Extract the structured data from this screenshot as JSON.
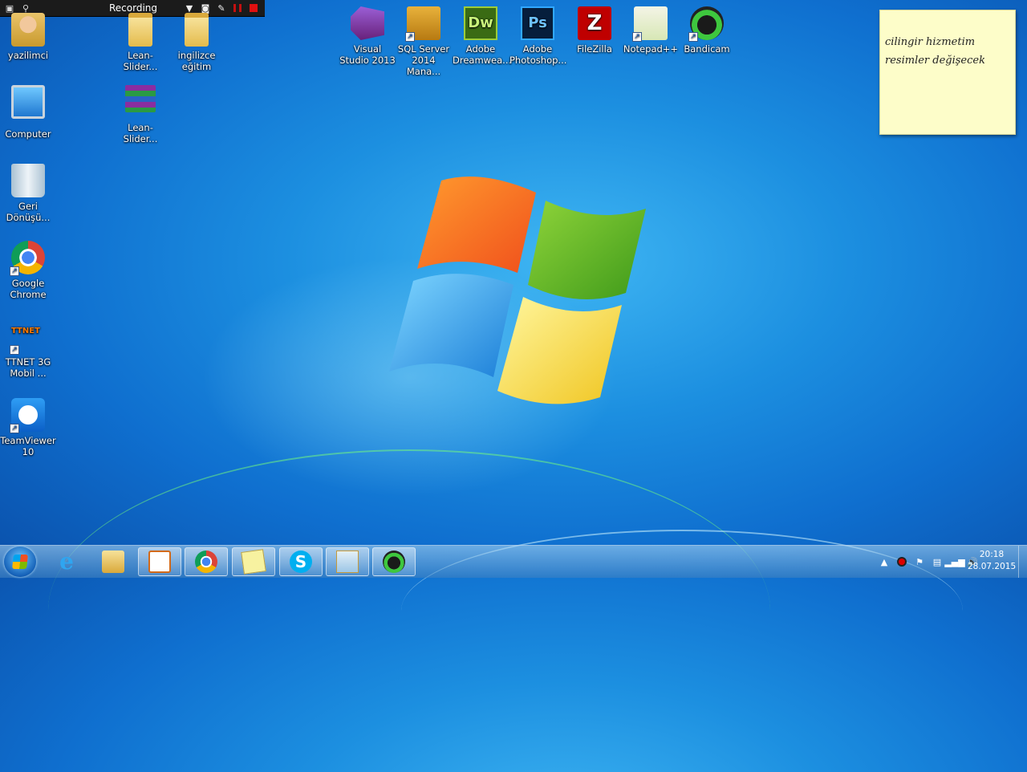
{
  "recorder": {
    "title": "Recording"
  },
  "desktop_icons": [
    {
      "id": "yazilimci",
      "label": "yazilimci"
    },
    {
      "id": "lean-slider-folder",
      "label": "Lean-Slider..."
    },
    {
      "id": "ingilizce-egitim",
      "label": "ingilizce eğitim"
    },
    {
      "id": "computer",
      "label": "Computer"
    },
    {
      "id": "lean-slider-rar",
      "label": "Lean-Slider..."
    },
    {
      "id": "recycle-bin",
      "label": "Geri Dönüşü..."
    },
    {
      "id": "google-chrome",
      "label": "Google Chrome"
    },
    {
      "id": "ttnet",
      "label": "TTNET 3G Mobil ..."
    },
    {
      "id": "teamviewer",
      "label": "TeamViewer 10"
    },
    {
      "id": "visual-studio",
      "label": "Visual Studio 2013"
    },
    {
      "id": "sql-server",
      "label": "SQL Server 2014 Mana..."
    },
    {
      "id": "dreamweaver",
      "label": "Adobe Dreamwea..."
    },
    {
      "id": "photoshop",
      "label": "Adobe Photoshop..."
    },
    {
      "id": "filezilla",
      "label": "FileZilla"
    },
    {
      "id": "notepadpp",
      "label": "Notepad++"
    },
    {
      "id": "bandicam",
      "label": "Bandicam"
    }
  ],
  "icon_text": {
    "ttnet": "TTNET",
    "dw": "Dw",
    "ps": "Ps",
    "fz": "Z",
    "ie": "e",
    "skype": "S"
  },
  "sticky_note": {
    "line1": "cilingir hizmetim",
    "line2": "resimler değişecek"
  },
  "clock": {
    "time": "20:18",
    "date": "28.07.2015"
  },
  "colors": {
    "desktop": "#1c8fe0",
    "sticky": "#fdfdc9"
  }
}
